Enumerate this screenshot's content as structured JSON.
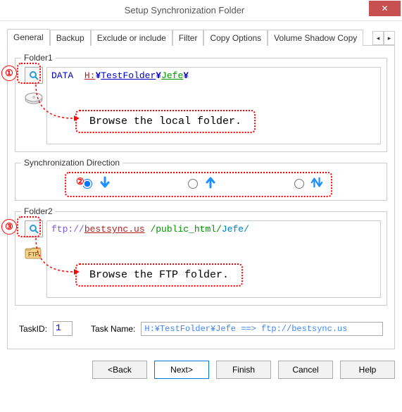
{
  "window": {
    "title": "Setup Synchronization Folder",
    "close": "✕"
  },
  "tabs": {
    "general": "General",
    "backup": "Backup",
    "exclude": "Exclude or include",
    "filter": "Filter",
    "copy": "Copy Options",
    "shadow": "Volume Shadow Copy",
    "scroll_left": "◂",
    "scroll_right": "▸"
  },
  "folder1": {
    "legend": "Folder1",
    "path_data": "DATA",
    "path_drive": "H:",
    "path_sep": "¥",
    "path_seg1": "TestFolder",
    "path_seg2": "Jefe",
    "callout_num": "①",
    "callout_text": "Browse the local folder."
  },
  "syncdir": {
    "legend": "Synchronization Direction",
    "callout_num": "②"
  },
  "folder2": {
    "legend": "Folder2",
    "scheme": "ftp://",
    "host": "bestsync.us",
    "path1": "/public_html",
    "slash": "/",
    "path2": "Jefe/",
    "callout_num": "③",
    "callout_text": "Browse the FTP folder."
  },
  "bottom": {
    "taskid_label": "TaskID:",
    "taskid_value": "1",
    "taskname_label": "Task Name:",
    "taskname_value": "H:¥TestFolder¥Jefe ==> ftp://bestsync.us"
  },
  "buttons": {
    "back": "<Back",
    "next": "Next>",
    "finish": "Finish",
    "cancel": "Cancel",
    "help": "Help"
  }
}
